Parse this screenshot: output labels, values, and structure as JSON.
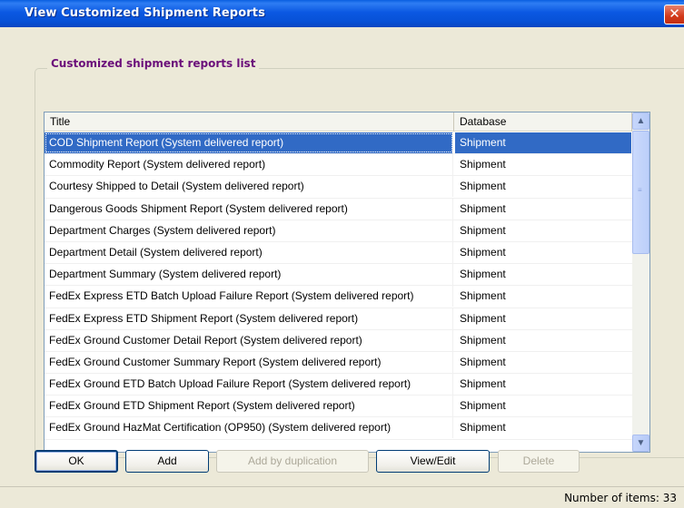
{
  "window": {
    "title": "View Customized Shipment Reports",
    "close_glyph": "✕"
  },
  "group": {
    "label": "Customized shipment reports list"
  },
  "list": {
    "columns": {
      "title": "Title",
      "database": "Database"
    },
    "rows": [
      {
        "title": "COD Shipment Report (System delivered report)",
        "database": "Shipment",
        "selected": true
      },
      {
        "title": "Commodity Report (System delivered report)",
        "database": "Shipment"
      },
      {
        "title": "Courtesy Shipped to Detail (System delivered report)",
        "database": "Shipment"
      },
      {
        "title": "Dangerous Goods Shipment Report (System delivered report)",
        "database": "Shipment"
      },
      {
        "title": "Department Charges (System delivered report)",
        "database": "Shipment"
      },
      {
        "title": "Department Detail (System delivered report)",
        "database": "Shipment"
      },
      {
        "title": "Department Summary (System delivered report)",
        "database": "Shipment"
      },
      {
        "title": "FedEx Express ETD Batch Upload Failure Report (System delivered report)",
        "database": "Shipment"
      },
      {
        "title": "FedEx Express ETD Shipment Report (System delivered report)",
        "database": "Shipment"
      },
      {
        "title": "FedEx Ground Customer Detail Report (System delivered report)",
        "database": "Shipment"
      },
      {
        "title": "FedEx Ground Customer Summary Report (System delivered report)",
        "database": "Shipment"
      },
      {
        "title": "FedEx Ground ETD Batch Upload Failure Report (System delivered report)",
        "database": "Shipment"
      },
      {
        "title": "FedEx Ground ETD Shipment Report (System delivered report)",
        "database": "Shipment"
      },
      {
        "title": "FedEx Ground HazMat Certification (OP950) (System delivered report)",
        "database": "Shipment"
      }
    ]
  },
  "scrollbar": {
    "up_glyph": "▲",
    "down_glyph": "▼",
    "grip_glyph": "≡"
  },
  "buttons": {
    "ok": "OK",
    "add": "Add",
    "add_by_duplication": "Add by duplication",
    "view_edit": "View/Edit",
    "delete": "Delete"
  },
  "status": {
    "count_label": "Number of items:",
    "count_value": "33"
  },
  "colors": {
    "titlebar": "#0b58e2",
    "selection": "#316ac5",
    "group_label": "#6b0f7a"
  }
}
